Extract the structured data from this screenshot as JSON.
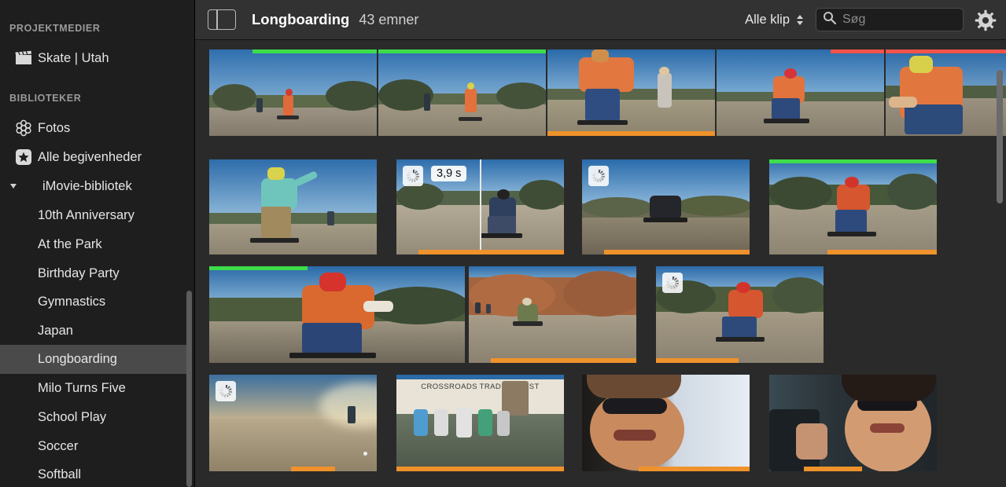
{
  "app": {
    "name": "iMovie",
    "accent_selected": "#4a4a4a",
    "favorite_color": "#3ddc4b",
    "rejected_color": "#f2534a",
    "keyword_color": "#f0922b"
  },
  "sidebar": {
    "sections": [
      {
        "title": "PROJEKTMEDIER",
        "items": [
          {
            "label": "Skate | Utah",
            "icon": "clapperboard-icon",
            "selected": false
          }
        ]
      },
      {
        "title": "BIBLIOTEKER",
        "items": [
          {
            "label": "Fotos",
            "icon": "photos-flower-icon",
            "selected": false
          },
          {
            "label": "Alle begivenheder",
            "icon": "star-icon",
            "selected": false
          },
          {
            "label": "iMovie-bibliotek",
            "icon": "disclosure-triangle-icon",
            "selected": false
          }
        ]
      }
    ],
    "events": [
      {
        "label": "10th Anniversary",
        "selected": false
      },
      {
        "label": "At the Park",
        "selected": false
      },
      {
        "label": "Birthday Party",
        "selected": false
      },
      {
        "label": "Gymnastics",
        "selected": false
      },
      {
        "label": "Japan",
        "selected": false
      },
      {
        "label": "Longboarding",
        "selected": true
      },
      {
        "label": "Milo Turns Five",
        "selected": false
      },
      {
        "label": "School Play",
        "selected": false
      },
      {
        "label": "Soccer",
        "selected": false
      },
      {
        "label": "Softball",
        "selected": false
      }
    ]
  },
  "toolbar": {
    "sidebar_toggle_name": "sidebar-toggle-icon",
    "title": "Longboarding",
    "count": "43 emner",
    "filter_label": "Alle klip",
    "search_placeholder": "Søg",
    "search_value": "",
    "settings_icon": "gear-icon"
  },
  "browser": {
    "clips": [
      {
        "id": "clip-1",
        "marker_top": "green",
        "marker_bottom": "none",
        "badge": "",
        "spinner": false
      },
      {
        "id": "clip-2",
        "marker_top": "green",
        "marker_bottom": "none",
        "badge": "",
        "spinner": false
      },
      {
        "id": "clip-3",
        "marker_top": "none",
        "marker_bottom": "orange",
        "badge": "",
        "spinner": false
      },
      {
        "id": "clip-4",
        "marker_top": "red",
        "marker_bottom": "none",
        "badge": "",
        "spinner": false
      },
      {
        "id": "clip-5",
        "marker_top": "red",
        "marker_bottom": "none",
        "badge": "",
        "spinner": false
      },
      {
        "id": "clip-6",
        "marker_top": "none",
        "marker_bottom": "none",
        "badge": "",
        "spinner": false
      },
      {
        "id": "clip-7",
        "marker_top": "none",
        "marker_bottom": "orange",
        "badge": "3,9 s",
        "spinner": true
      },
      {
        "id": "clip-8",
        "marker_top": "none",
        "marker_bottom": "orange",
        "badge": "",
        "spinner": true
      },
      {
        "id": "clip-9",
        "marker_top": "green",
        "marker_bottom": "orange",
        "badge": "",
        "spinner": false
      },
      {
        "id": "clip-10",
        "marker_top": "green",
        "marker_bottom": "orange",
        "badge": "",
        "spinner": false
      },
      {
        "id": "clip-11",
        "marker_top": "none",
        "marker_bottom": "orange",
        "badge": "",
        "spinner": true
      },
      {
        "id": "clip-12",
        "marker_top": "none",
        "marker_bottom": "orange",
        "badge": "",
        "spinner": true
      },
      {
        "id": "clip-13",
        "marker_top": "none",
        "marker_bottom": "orange",
        "badge": "",
        "spinner": true
      },
      {
        "id": "clip-14",
        "marker_top": "none",
        "marker_bottom": "orange",
        "badge": "",
        "spinner": false
      },
      {
        "id": "clip-15",
        "marker_top": "none",
        "marker_bottom": "orange",
        "badge": "",
        "spinner": false
      },
      {
        "id": "clip-16",
        "marker_top": "none",
        "marker_bottom": "orange",
        "badge": "",
        "spinner": false
      }
    ],
    "sign_text": "CROSSROADS TRADING POST"
  }
}
